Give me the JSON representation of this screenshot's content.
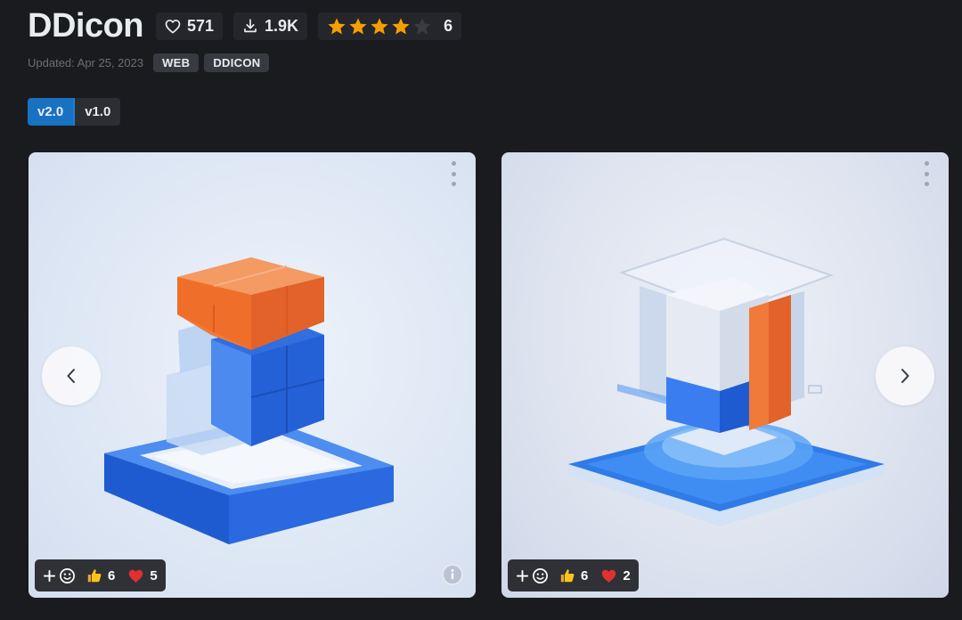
{
  "header": {
    "title": "DDicon",
    "likes": "571",
    "downloads": "1.9K",
    "rating": {
      "stars_filled": 4,
      "stars_total": 5,
      "count": "6"
    }
  },
  "meta": {
    "updated": "Updated: Apr 25, 2023",
    "tags": [
      "WEB",
      "DDICON"
    ]
  },
  "versions": [
    {
      "label": "v2.0",
      "active": true
    },
    {
      "label": "v1.0",
      "active": false
    }
  ],
  "cards": [
    {
      "thumbs_up": "6",
      "hearts": "5"
    },
    {
      "thumbs_up": "6",
      "hearts": "2"
    }
  ],
  "colors": {
    "background": "#1a1b1e",
    "accent": "#1971c2",
    "star": "#f59f00",
    "heart": "#e03131",
    "orange": "#f07a3a",
    "blue": "#2f6fe0"
  },
  "icons": {
    "like": "heart-outline-icon",
    "download": "download-icon",
    "star": "star-icon",
    "prev": "chevron-left-icon",
    "next": "chevron-right-icon",
    "more": "kebab-menu-icon",
    "add_reaction": "plus-icon",
    "smile": "smile-icon",
    "thumbs_up": "thumbs-up-icon",
    "heart": "heart-icon",
    "info": "info-icon"
  }
}
